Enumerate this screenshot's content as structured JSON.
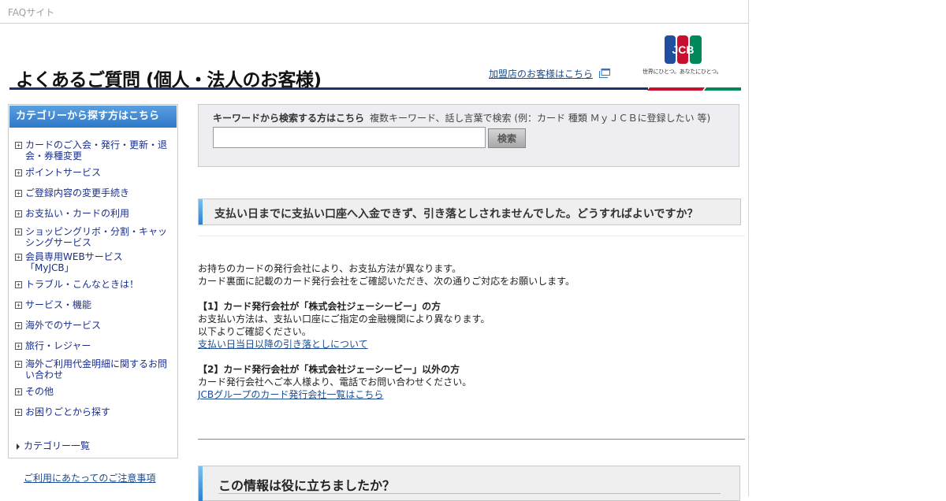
{
  "site_label": "FAQサイト",
  "header": {
    "title": "よくあるご質問 (個人・法人のお客様)",
    "merchant_link": "加盟店のお客様はこちら",
    "logo_text": "JCB",
    "logo_tagline": "世界にひとつ。あなたにひとつ。"
  },
  "sidebar": {
    "heading": "カテゴリーから探す方はこちら",
    "items": [
      {
        "label": "カードのご入会・発行・更新・退会・券種変更"
      },
      {
        "label": "ポイントサービス"
      },
      {
        "label": "ご登録内容の変更手続き"
      },
      {
        "label": "お支払い・カードの利用"
      },
      {
        "label": "ショッピングリボ・分割・キャッシングサービス"
      },
      {
        "label": "会員専用WEBサービス「MyJCB」"
      },
      {
        "label": "トラブル・こんなときは！"
      },
      {
        "label": "サービス・機能"
      },
      {
        "label": "海外でのサービス"
      },
      {
        "label": "旅行・レジャー"
      },
      {
        "label": "海外ご利用代金明細に関するお問い合わせ"
      },
      {
        "label": "その他"
      },
      {
        "label": "お困りごとから探す"
      }
    ],
    "all_categories": "カテゴリー一覧",
    "notice_link": "ご利用にあたってのご注意事項"
  },
  "search": {
    "label": "キーワードから検索する方はこちら",
    "hint": "複数キーワード、話し言葉で検索 (例：カード 種類 ＭｙＪＣＢに登録したい 等)",
    "value": "",
    "button": "検索"
  },
  "question": "支払い日までに支払い口座へ入金できず、引き落としされませんでした。どうすればよいですか？",
  "answer": {
    "intro1": "お持ちのカードの発行会社により、お支払方法が異なります。",
    "intro2": "カード裏面に記載のカード発行会社をご確認いただき、次の通りご対応をお願いします。",
    "case1_title": "【1】カード発行会社が「株式会社ジェーシービー」の方",
    "case1_line1": "お支払い方法は、支払い口座にご指定の金融機関により異なります。",
    "case1_line2": "以下よりご確認ください。",
    "case1_link": "支払い日当日以降の引き落としについて",
    "case2_title": "【2】カード発行会社が「株式会社ジェーシービー」以外の方",
    "case2_line1": "カード発行会社へご本人様より、電話でお問い合わせください。",
    "case2_link": "JCBグループのカード発行会社一覧はこちら"
  },
  "feedback": {
    "heading": "この情報は役に立ちましたか？"
  },
  "colors": {
    "nav_blue": "#1a2e8c",
    "link_blue": "#1a4d91",
    "rule_navy": "#1e2f6e",
    "jcb_blue": "#1f4f9e",
    "jcb_red": "#c8102e",
    "jcb_green": "#00875a"
  }
}
